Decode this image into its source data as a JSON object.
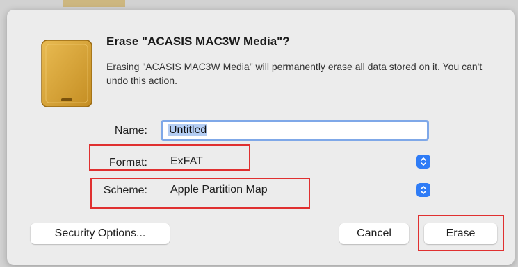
{
  "dialog": {
    "title": "Erase \"ACASIS MAC3W Media\"?",
    "message": "Erasing \"ACASIS MAC3W Media\" will permanently erase all data stored on it. You can't undo this action.",
    "icon": "external-drive-icon"
  },
  "form": {
    "name_label": "Name:",
    "name_value": "Untitled",
    "format_label": "Format:",
    "format_value": "ExFAT",
    "scheme_label": "Scheme:",
    "scheme_value": "Apple Partition Map"
  },
  "buttons": {
    "security_options": "Security Options...",
    "cancel": "Cancel",
    "erase": "Erase"
  },
  "colors": {
    "accent": "#2f7cf6",
    "annotation": "#e03030",
    "drive": "#d9a43a"
  }
}
